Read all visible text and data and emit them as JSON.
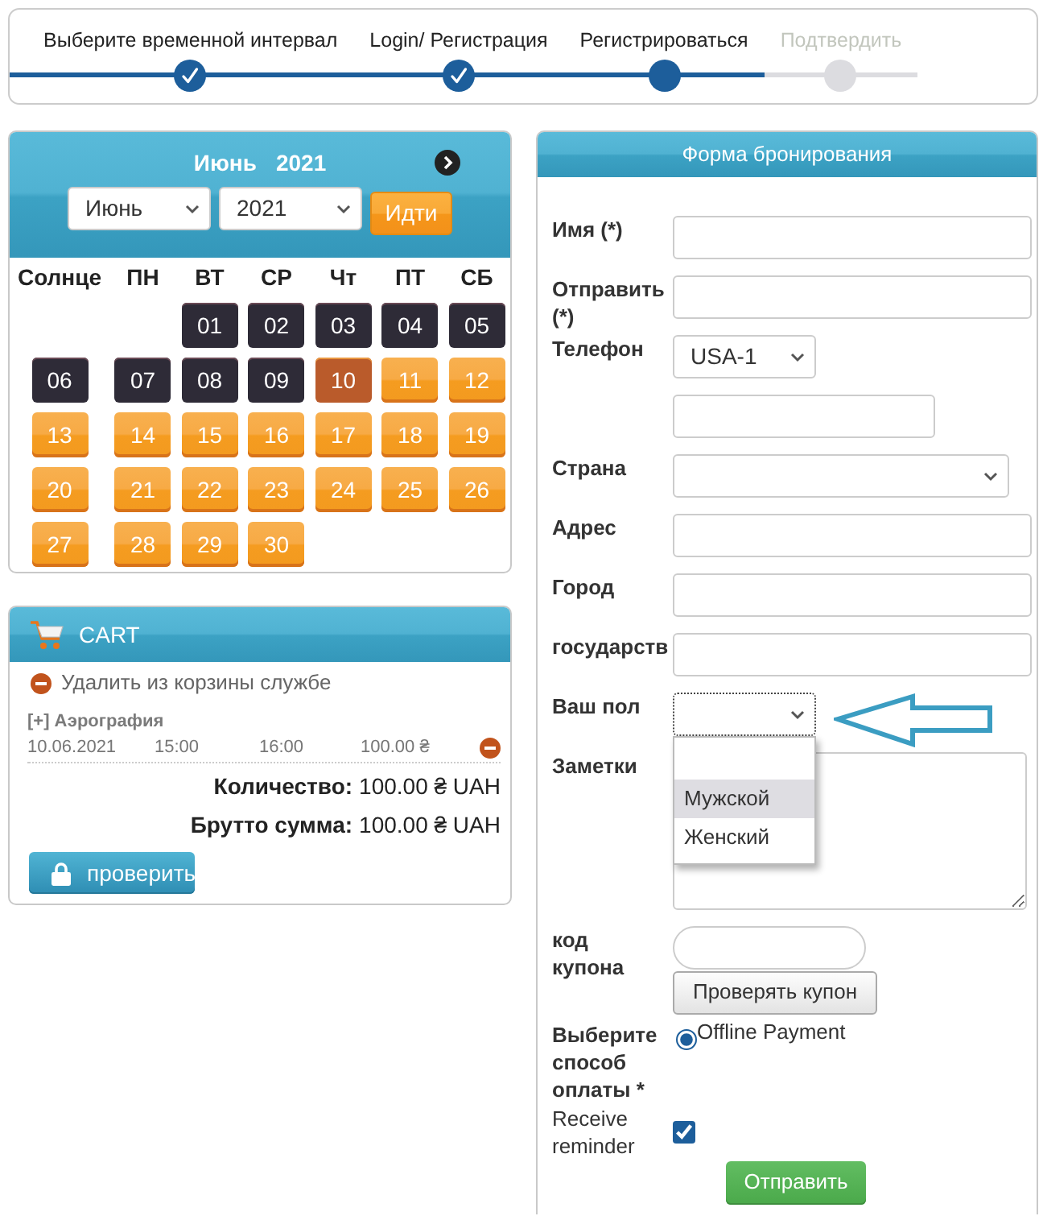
{
  "stepper": {
    "steps": [
      {
        "label": "Выберите временной интервал",
        "completed": true
      },
      {
        "label": "Login/ Регистрация",
        "completed": true
      },
      {
        "label": "Регистрироваться",
        "completed": false
      },
      {
        "label": "Подтвердить",
        "completed": false
      }
    ]
  },
  "calendar": {
    "title_month": "Июнь",
    "title_year": "2021",
    "month_select": "Июнь",
    "year_select": "2021",
    "go_button": "Идти",
    "weekdays": [
      "Солнце",
      "ПН",
      "ВТ",
      "СР",
      "Чт",
      "ПТ",
      "СБ"
    ],
    "weeks": [
      [
        {
          "day": "01",
          "disabled": true,
          "selected": false
        },
        {
          "day": "02",
          "disabled": true,
          "selected": false
        },
        {
          "day": "03",
          "disabled": true,
          "selected": false
        },
        {
          "day": "04",
          "disabled": true,
          "selected": false
        },
        {
          "day": "05",
          "disabled": true,
          "selected": false
        }
      ],
      [
        {
          "day": "06",
          "disabled": true,
          "selected": false
        },
        {
          "day": "07",
          "disabled": true,
          "selected": false
        },
        {
          "day": "08",
          "disabled": true,
          "selected": false
        },
        {
          "day": "09",
          "disabled": true,
          "selected": false
        },
        {
          "day": "10",
          "disabled": false,
          "selected": true
        },
        {
          "day": "11",
          "disabled": false,
          "selected": false
        },
        {
          "day": "12",
          "disabled": false,
          "selected": false
        }
      ],
      [
        {
          "day": "13",
          "disabled": false,
          "selected": false
        },
        {
          "day": "14",
          "disabled": false,
          "selected": false
        },
        {
          "day": "15",
          "disabled": false,
          "selected": false
        },
        {
          "day": "16",
          "disabled": false,
          "selected": false
        },
        {
          "day": "17",
          "disabled": false,
          "selected": false
        },
        {
          "day": "18",
          "disabled": false,
          "selected": false
        },
        {
          "day": "19",
          "disabled": false,
          "selected": false
        }
      ],
      [
        {
          "day": "20",
          "disabled": false,
          "selected": false
        },
        {
          "day": "21",
          "disabled": false,
          "selected": false
        },
        {
          "day": "22",
          "disabled": false,
          "selected": false
        },
        {
          "day": "23",
          "disabled": false,
          "selected": false
        },
        {
          "day": "24",
          "disabled": false,
          "selected": false
        },
        {
          "day": "25",
          "disabled": false,
          "selected": false
        },
        {
          "day": "26",
          "disabled": false,
          "selected": false
        }
      ],
      [
        {
          "day": "27",
          "disabled": false,
          "selected": false
        },
        {
          "day": "28",
          "disabled": false,
          "selected": false
        },
        {
          "day": "29",
          "disabled": false,
          "selected": false
        },
        {
          "day": "30",
          "disabled": false,
          "selected": false
        }
      ]
    ]
  },
  "cart": {
    "title": "CART",
    "remove_all": "Удалить из корзины службе",
    "items": [
      {
        "title": "[+] Аэрография",
        "date": "10.06.2021",
        "start": "15:00",
        "end": "16:00",
        "price": "100.00 ₴"
      }
    ],
    "totals": [
      {
        "label": "Количество:",
        "value": "100.00 ₴ UAH"
      },
      {
        "label": "Брутто сумма:",
        "value": "100.00 ₴ UAH"
      }
    ],
    "checkout_button": "проверить"
  },
  "booking_form": {
    "title": "Форма бронирования",
    "fields": [
      {
        "kind": "text",
        "label": "Имя (*)"
      },
      {
        "kind": "text",
        "label": "Отправить (*)"
      },
      {
        "kind": "phone",
        "label": "Телефон",
        "code": "USA-1"
      },
      {
        "kind": "select",
        "label": "Страна"
      },
      {
        "kind": "text",
        "label": "Адрес"
      },
      {
        "kind": "text",
        "label": "Город"
      },
      {
        "kind": "text",
        "label": "государств"
      },
      {
        "kind": "picker",
        "label": "Ваш пол",
        "expanded": true,
        "pointed_at": true,
        "options": [
          {
            "label": "Мужской",
            "selected": true
          },
          {
            "label": "Женский",
            "selected": false
          }
        ]
      },
      {
        "kind": "textarea",
        "label": "Заметки"
      },
      {
        "kind": "coupon",
        "label": "код купона",
        "button": "Проверять купон"
      },
      {
        "kind": "radio",
        "label": "Выберите способ оплаты *",
        "options": [
          {
            "label": "Offline Payment",
            "selected": true
          }
        ]
      },
      {
        "kind": "checkbox",
        "label": "Receive reminder",
        "checked": true
      }
    ],
    "submit_button": "Отправить"
  }
}
